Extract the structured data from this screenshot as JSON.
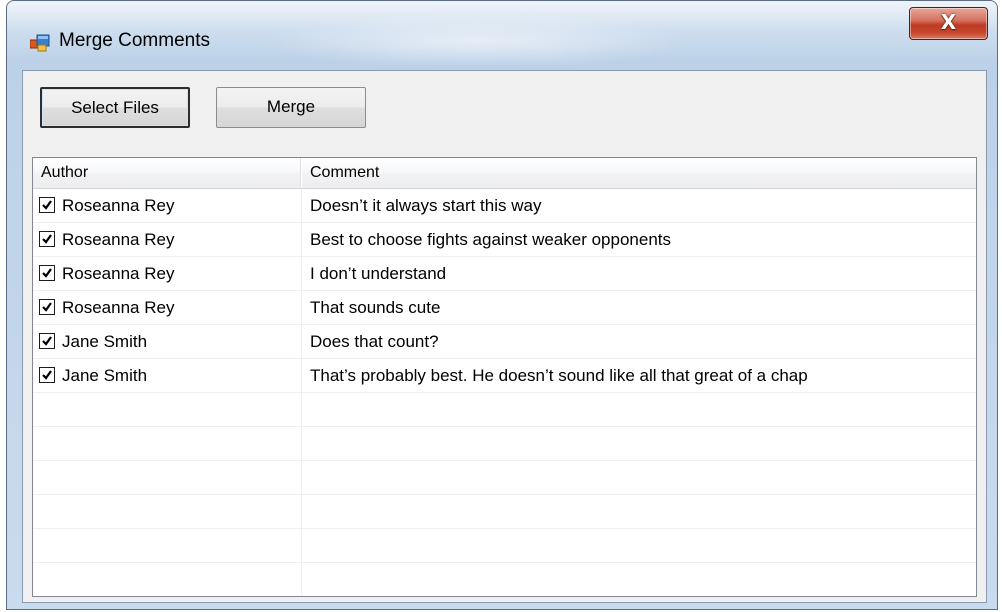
{
  "window": {
    "title": "Merge Comments",
    "close_glyph": "X",
    "icon": "app-window-icon"
  },
  "toolbar": {
    "select_files_label": "Select Files",
    "merge_label": "Merge"
  },
  "comments_list": {
    "columns": [
      "Author",
      "Comment"
    ],
    "rows": [
      {
        "checked": true,
        "author": "Roseanna Rey",
        "comment": "Doesn’t it always start this way"
      },
      {
        "checked": true,
        "author": "Roseanna Rey",
        "comment": "Best to choose fights against weaker opponents"
      },
      {
        "checked": true,
        "author": "Roseanna Rey",
        "comment": "I don’t understand"
      },
      {
        "checked": true,
        "author": "Roseanna Rey",
        "comment": "That sounds cute"
      },
      {
        "checked": true,
        "author": "Jane Smith",
        "comment": "Does that count?"
      },
      {
        "checked": true,
        "author": "Jane Smith",
        "comment": "That’s probably best. He doesn’t sound like all that great of a chap"
      }
    ]
  },
  "colors": {
    "close_button": "#c7462d",
    "client_background": "#f0f0f0",
    "list_background": "#ffffff"
  }
}
